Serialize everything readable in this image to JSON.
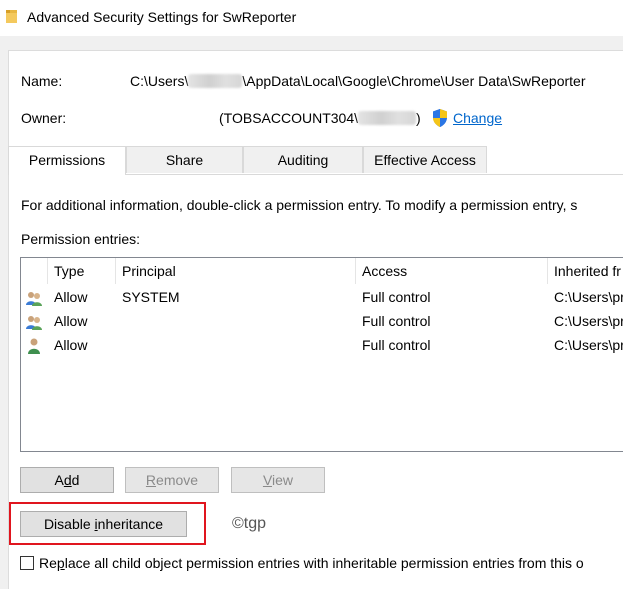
{
  "window": {
    "title": "Advanced Security Settings for SwReporter",
    "icon": "folder-icon"
  },
  "name": {
    "label": "Name:",
    "path_prefix": "C:\\Users\\",
    "path_suffix": "\\AppData\\Local\\Google\\Chrome\\User Data\\SwReporter"
  },
  "owner": {
    "label": "Owner:",
    "value_prefix": "(TOBSACCOUNT304\\",
    "value_suffix": ")",
    "change_link": "Change"
  },
  "tabs": [
    {
      "label": "Permissions",
      "active": true
    },
    {
      "label": "Share",
      "active": false
    },
    {
      "label": "Auditing",
      "active": false
    },
    {
      "label": "Effective Access",
      "active": false
    }
  ],
  "info_text": "For additional information, double-click a permission entry. To modify a permission entry, s",
  "entries_label": "Permission entries:",
  "table": {
    "columns": [
      "Type",
      "Principal",
      "Access",
      "Inherited fr"
    ],
    "rows": [
      {
        "icon": "group-users-icon",
        "type": "Allow",
        "principal": "SYSTEM",
        "access": "Full control",
        "inherited": "C:\\Users\\pr"
      },
      {
        "icon": "group-users-icon",
        "type": "Allow",
        "principal": "",
        "access": "Full control",
        "inherited": "C:\\Users\\pr"
      },
      {
        "icon": "single-user-icon",
        "type": "Allow",
        "principal": "",
        "access": "Full control",
        "inherited": "C:\\Users\\pr"
      }
    ]
  },
  "buttons": {
    "add": {
      "pre": "A",
      "key": "d",
      "post": "d"
    },
    "remove": {
      "pre": "",
      "key": "R",
      "post": "emove"
    },
    "view": {
      "pre": "",
      "key": "V",
      "post": "iew"
    },
    "disable_inheritance": {
      "pre": "Disable ",
      "key": "i",
      "post": "nheritance"
    }
  },
  "watermark": "©tgp",
  "replace_checkbox": {
    "pre": "Re",
    "key": "p",
    "post": "lace all child object permission entries with inheritable permission entries from this o",
    "checked": false
  },
  "colors": {
    "highlight": "#e0151e",
    "link": "#0066cc"
  }
}
